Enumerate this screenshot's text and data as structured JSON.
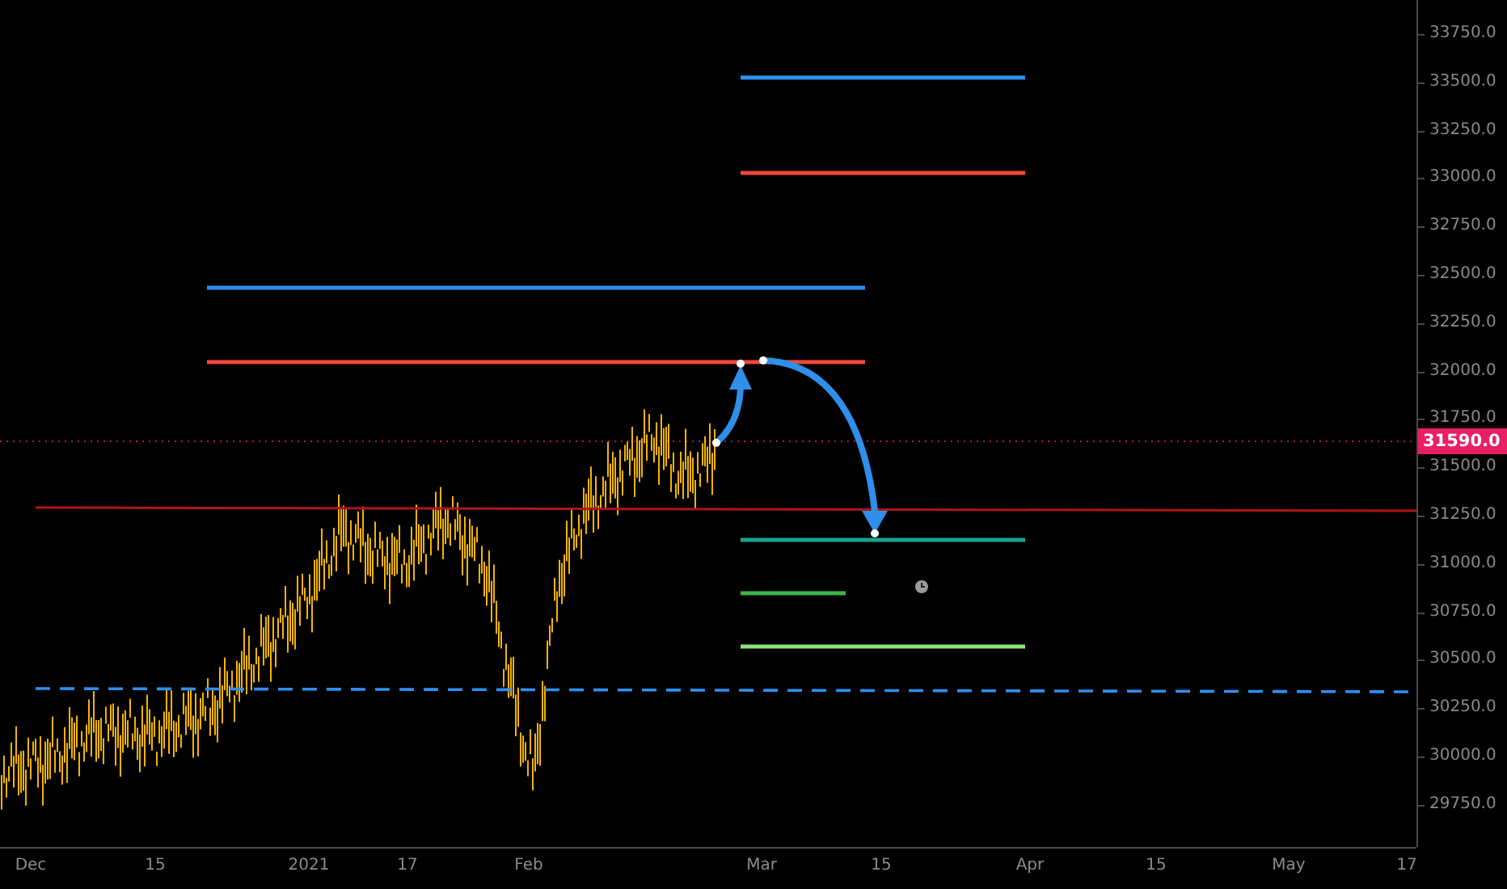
{
  "price_axis": {
    "labels": [
      "33750.0",
      "33500.0",
      "33250.0",
      "33000.0",
      "32750.0",
      "32500.0",
      "32250.0",
      "32000.0",
      "31750.0",
      "31500.0",
      "31250.0",
      "31000.0",
      "30750.0",
      "30500.0",
      "30250.0",
      "30000.0",
      "29750.0"
    ],
    "last_price": "31590.0"
  },
  "time_axis": {
    "labels": [
      "Dec",
      "15",
      "2021",
      "17",
      "Feb",
      "Mar",
      "15",
      "Apr",
      "15",
      "May",
      "17"
    ]
  }
}
